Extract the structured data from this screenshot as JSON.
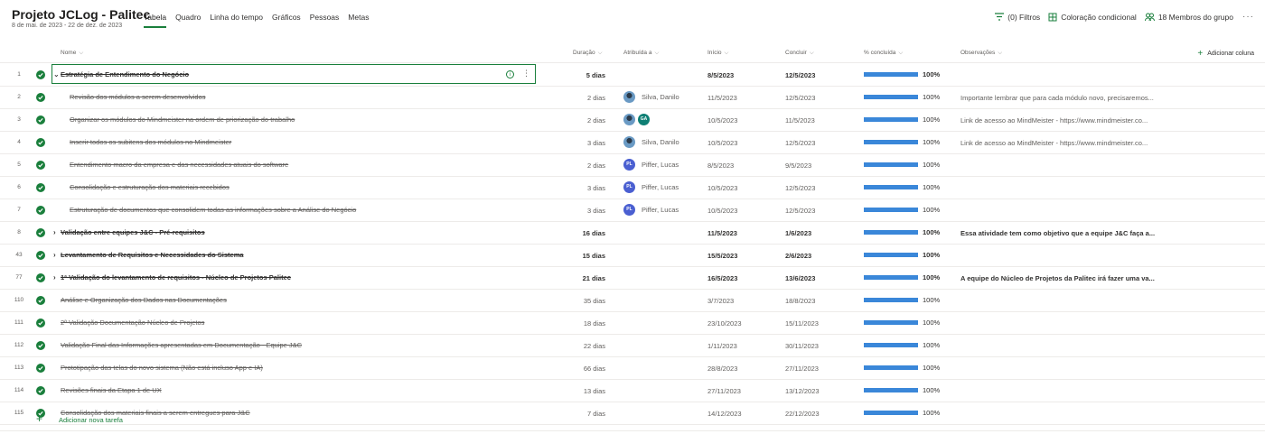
{
  "project": {
    "title": "Projeto JCLog - Palitec",
    "dates": "8 de mai. de 2023 - 22 de dez. de 2023"
  },
  "tabs": [
    "Tabela",
    "Quadro",
    "Linha do tempo",
    "Gráficos",
    "Pessoas",
    "Metas"
  ],
  "active_tab": "Tabela",
  "actions": {
    "filters": "(0) Filtros",
    "conditional": "Coloração condicional",
    "members": "18 Membros do grupo",
    "more": "···"
  },
  "columns": {
    "nome": "Nome",
    "duracao": "Duração",
    "atribuida": "Atribuída a",
    "inicio": "Início",
    "concluir": "Concluir",
    "pct": "% concluída",
    "obs": "Observações",
    "add": "Adicionar coluna"
  },
  "rows": [
    {
      "num": "1",
      "name": "Estratégia de Entendimento do Negócio",
      "parent": true,
      "expanded": true,
      "selected": true,
      "dur": "5 dias",
      "assign": [],
      "start": "8/5/2023",
      "end": "12/5/2023",
      "pct": 1.0,
      "pct_label": "100%",
      "obs": ""
    },
    {
      "num": "2",
      "name": "Revisão dos módulos a serem desenvolvidos",
      "indent": 2,
      "dur": "2 dias",
      "assign": [
        {
          "type": "photo"
        }
      ],
      "assign_name": "Silva, Danilo",
      "start": "11/5/2023",
      "end": "12/5/2023",
      "pct": 1.0,
      "pct_label": "100%",
      "obs": "Importante lembrar que para cada módulo novo, precisaremos..."
    },
    {
      "num": "3",
      "name": "Organizar os módulos do Mindmeister na ordem de priorização do trabalho",
      "indent": 2,
      "dur": "2 dias",
      "assign": [
        {
          "type": "photo"
        },
        {
          "type": "ga",
          "initials": "GA"
        }
      ],
      "assign_name": "",
      "start": "10/5/2023",
      "end": "11/5/2023",
      "pct": 1.0,
      "pct_label": "100%",
      "obs": "Link de acesso ao MindMeister - https://www.mindmeister.co..."
    },
    {
      "num": "4",
      "name": "Inserir todos os subitens dos módulos no Mindmeister",
      "indent": 2,
      "dur": "3 dias",
      "assign": [
        {
          "type": "photo"
        }
      ],
      "assign_name": "Silva, Danilo",
      "start": "10/5/2023",
      "end": "12/5/2023",
      "pct": 1.0,
      "pct_label": "100%",
      "obs": "Link de acesso ao MindMeister - https://www.mindmeister.co..."
    },
    {
      "num": "5",
      "name": "Entendimento macro da empresa e das necessidades atuais do software",
      "indent": 2,
      "dur": "2 dias",
      "assign": [
        {
          "type": "pl",
          "initials": "PL"
        }
      ],
      "assign_name": "Piffer, Lucas",
      "start": "8/5/2023",
      "end": "9/5/2023",
      "pct": 1.0,
      "pct_label": "100%",
      "obs": ""
    },
    {
      "num": "6",
      "name": "Consolidação e estruturação dos materiais recebidos",
      "indent": 2,
      "dur": "3 dias",
      "assign": [
        {
          "type": "pl",
          "initials": "PL"
        }
      ],
      "assign_name": "Piffer, Lucas",
      "start": "10/5/2023",
      "end": "12/5/2023",
      "pct": 1.0,
      "pct_label": "100%",
      "obs": ""
    },
    {
      "num": "7",
      "name": "Estruturação de documentos que consolidem todas as informações sobre a Análise do Negócio",
      "indent": 2,
      "dur": "3 dias",
      "assign": [
        {
          "type": "pl",
          "initials": "PL"
        }
      ],
      "assign_name": "Piffer, Lucas",
      "start": "10/5/2023",
      "end": "12/5/2023",
      "pct": 1.0,
      "pct_label": "100%",
      "obs": ""
    },
    {
      "num": "8",
      "name": "Validação entre equipes J&C - Pré-requisitos",
      "parent": true,
      "expanded": false,
      "dur": "16 dias",
      "assign": [],
      "start": "11/5/2023",
      "end": "1/6/2023",
      "pct": 1.0,
      "pct_label": "100%",
      "obs": "Essa atividade tem como objetivo que a equipe J&C faça a..."
    },
    {
      "num": "43",
      "name": "Levantamento de Requisitos e Necessidades do Sistema",
      "parent": true,
      "expanded": false,
      "dur": "15 dias",
      "assign": [],
      "start": "15/5/2023",
      "end": "2/6/2023",
      "pct": 1.0,
      "pct_label": "100%",
      "obs": ""
    },
    {
      "num": "77",
      "name": "1ª Validação do levantamento de requisitos - Núcleo de Projetos Palitec",
      "parent": true,
      "expanded": false,
      "dur": "21 dias",
      "assign": [],
      "start": "16/5/2023",
      "end": "13/6/2023",
      "pct": 1.0,
      "pct_label": "100%",
      "obs": "A equipe do Núcleo de Projetos da Palitec irá fazer uma va..."
    },
    {
      "num": "110",
      "name": "Análise e Organização dos Dados nas Documentações",
      "indent": 1,
      "dur": "35 dias",
      "assign": [],
      "start": "3/7/2023",
      "end": "18/8/2023",
      "pct": 1.0,
      "pct_label": "100%",
      "obs": ""
    },
    {
      "num": "111",
      "name": "2ª Validação Documentação Núcleo de Projetos",
      "indent": 1,
      "dur": "18 dias",
      "assign": [],
      "start": "23/10/2023",
      "end": "15/11/2023",
      "pct": 1.0,
      "pct_label": "100%",
      "obs": ""
    },
    {
      "num": "112",
      "name": "Validação Final das Informações apresentadas em Documentação - Equipe J&C",
      "indent": 1,
      "dur": "22 dias",
      "assign": [],
      "start": "1/11/2023",
      "end": "30/11/2023",
      "pct": 1.0,
      "pct_label": "100%",
      "obs": ""
    },
    {
      "num": "113",
      "name": "Prototipação das telas do novo sistema (Não está incluso App e IA)",
      "indent": 1,
      "dur": "66 dias",
      "assign": [],
      "start": "28/8/2023",
      "end": "27/11/2023",
      "pct": 1.0,
      "pct_label": "100%",
      "obs": ""
    },
    {
      "num": "114",
      "name": "Revisões finais da Etapa 1 de UX",
      "indent": 1,
      "dur": "13 dias",
      "assign": [],
      "start": "27/11/2023",
      "end": "13/12/2023",
      "pct": 1.0,
      "pct_label": "100%",
      "obs": ""
    },
    {
      "num": "115",
      "name": "Consolidação dos materiais finais a serem entregues para J&C",
      "indent": 1,
      "dur": "7 dias",
      "assign": [],
      "start": "14/12/2023",
      "end": "22/12/2023",
      "pct": 1.0,
      "pct_label": "100%",
      "obs": ""
    }
  ],
  "add_task": "Adicionar nova tarefa",
  "colors": {
    "accent": "#1a7f3c",
    "progress": "#3a87d9"
  }
}
